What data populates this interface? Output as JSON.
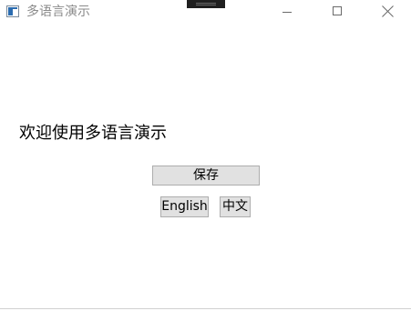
{
  "window": {
    "title": "多语言演示",
    "app_icon": "window-app-icon",
    "controls": {
      "minimize_icon": "minimize-icon",
      "maximize_icon": "maximize-icon",
      "close_icon": "close-icon"
    }
  },
  "main": {
    "welcome_text": "欢迎使用多语言演示",
    "save_label": "保存",
    "english_label": "English",
    "chinese_label": "中文"
  },
  "colors": {
    "button_background": "#e1e1e1",
    "button_border": "#adadad",
    "title_text": "#8a8a8a"
  }
}
